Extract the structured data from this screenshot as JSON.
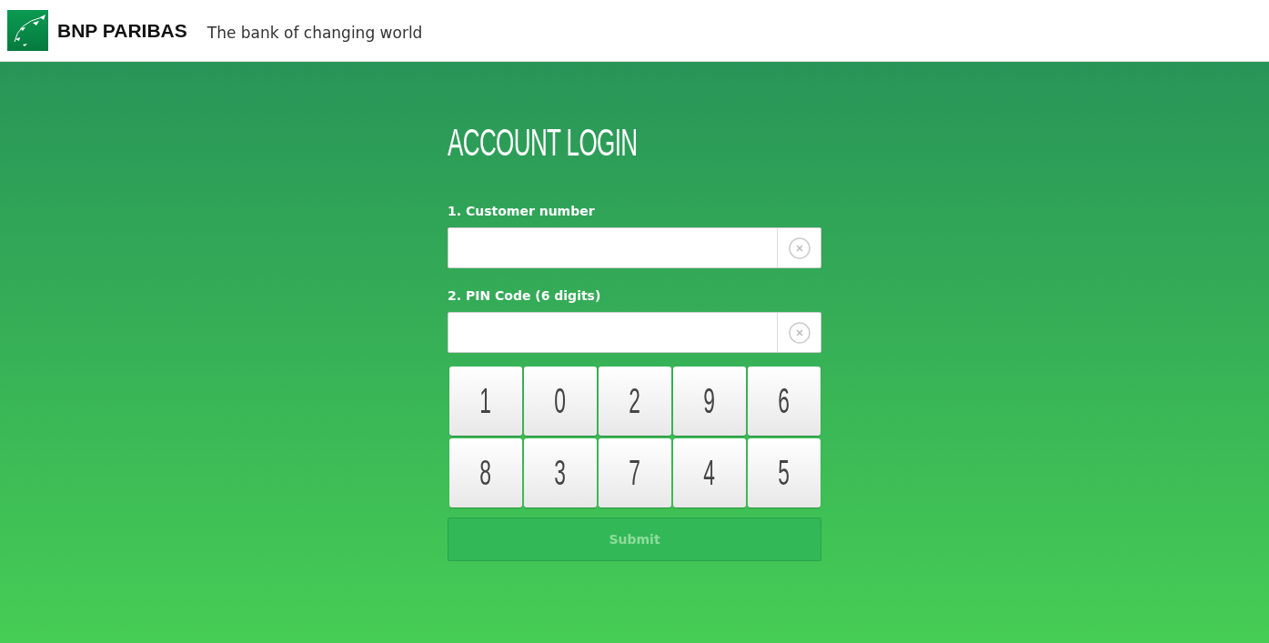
{
  "header": {
    "brand": "BNP PARIBAS",
    "tagline": "The bank of changing world"
  },
  "title": "ACCOUNT LOGIN",
  "fields": [
    {
      "label": "1. Customer number"
    },
    {
      "label": "2. PIN Code (6 digits)"
    }
  ],
  "keypad": {
    "keys": [
      "1",
      "0",
      "2",
      "9",
      "6",
      "8",
      "3",
      "7",
      "4",
      "5"
    ]
  },
  "submit": {
    "label": "Submit",
    "disabled": true
  }
}
